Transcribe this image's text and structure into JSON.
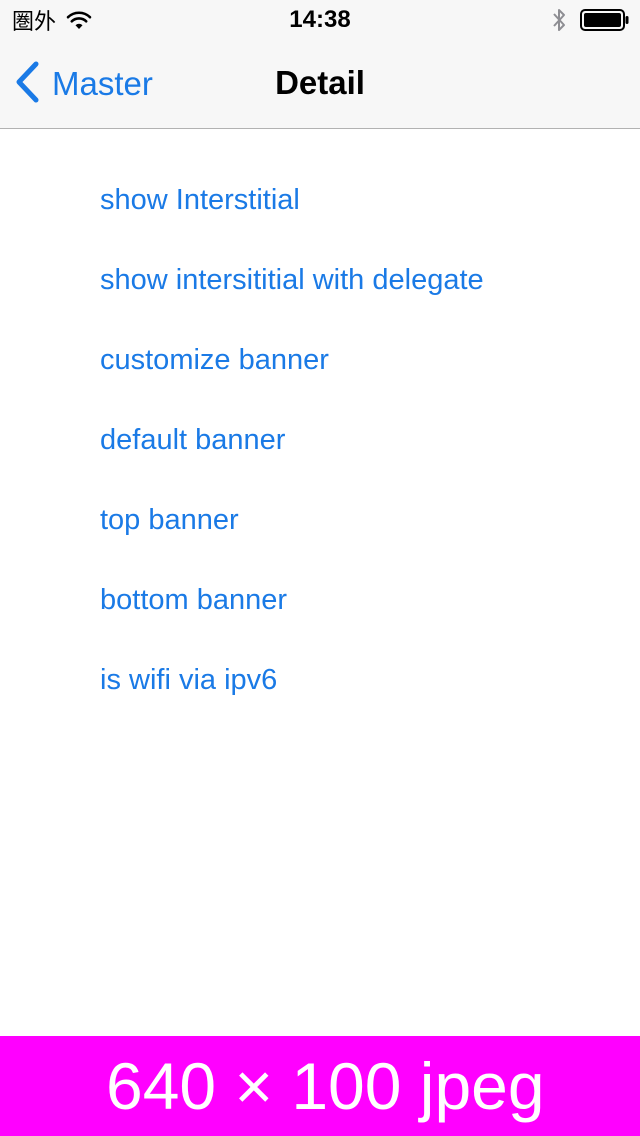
{
  "status_bar": {
    "carrier": "圏外",
    "time": "14:38",
    "icons": [
      "wifi-icon",
      "bluetooth-icon",
      "battery-icon"
    ]
  },
  "nav": {
    "back_label": "Master",
    "title": "Detail"
  },
  "menu": {
    "items": [
      {
        "label": "show Interstitial"
      },
      {
        "label": "show intersititial with delegate"
      },
      {
        "label": "customize banner"
      },
      {
        "label": "default banner"
      },
      {
        "label": "top banner"
      },
      {
        "label": "bottom banner"
      },
      {
        "label": "is wifi via ipv6"
      }
    ]
  },
  "ad_banner": {
    "label": "640 × 100 jpeg",
    "background": "#ff00ff"
  },
  "colors": {
    "accent": "#1a7ae6",
    "bar_background": "#f7f7f7",
    "separator": "#b2b2b2"
  }
}
